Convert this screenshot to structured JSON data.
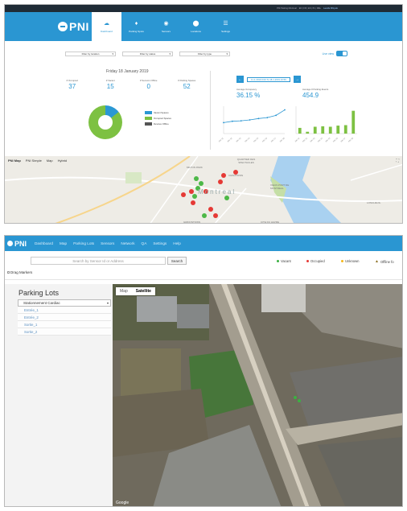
{
  "top": {
    "darkbar": {
      "user": "PNI Parking Montreal",
      "links": "EN | FR | ES | PL | MEL",
      "logout": "Lavalle Mbiyele"
    },
    "brand": "PNI",
    "tabs": [
      {
        "label": "Dashboard",
        "icon": "cloud-icon"
      },
      {
        "label": "Parking Spots",
        "icon": "pin-icon"
      },
      {
        "label": "Sensors",
        "icon": "sensor-icon"
      },
      {
        "label": "Locations",
        "icon": "location-icon"
      },
      {
        "label": "Settings",
        "icon": "sliders-icon"
      }
    ],
    "filters": [
      "Filter by location",
      "Filter by status",
      "Filter by type"
    ],
    "live_label": "Live view",
    "date": "Friday 18 January 2019",
    "stats": [
      {
        "label": "# Occupied",
        "value": "37"
      },
      {
        "label": "# Vacant",
        "value": "15"
      },
      {
        "label": "# Sensors Offline",
        "value": "0"
      },
      {
        "label": "# Parking Spaces",
        "value": "52"
      }
    ],
    "legend": [
      "Vacant Spaces",
      "Occupied Spaces",
      "Devices Offline"
    ],
    "colors": {
      "vacant": "#2b98d3",
      "occupied": "#7dc142",
      "offline": "#555555",
      "accent": "#2a96d2"
    },
    "range_text": "11-1-2019 0:00 To 18-1-2019 23:59",
    "avg_occupancy_label": "Average Occupancy",
    "avg_occupancy_value": "36.15 %",
    "avg_parking_label": "Average # Parking Events",
    "avg_parking_value": "454.9",
    "map_tabs": [
      "PNI Map",
      "PNI Simple",
      "Map",
      "Hybrid"
    ],
    "map_labels": [
      "MILTON PARK",
      "QUARTIER DES SPECTACLES",
      "CHINATOWN",
      "VIEUX-PORT DE MONTREAL",
      "Montreal",
      "GRIFFINTOWN",
      "CITE DU HAVRE",
      "LONGUEUIL"
    ]
  },
  "chart_data": [
    {
      "type": "line",
      "x": [
        "Jan 11",
        "Jan 12",
        "Jan 13",
        "Jan 14",
        "Jan 15",
        "Jan 16",
        "Jan 17",
        "Jan 18"
      ],
      "values": [
        24,
        27,
        28,
        30,
        33,
        35,
        40,
        52
      ],
      "ylim": [
        0,
        60
      ]
    },
    {
      "type": "bar",
      "categories": [
        "Jan 11",
        "Jan 12",
        "Jan 13",
        "Jan 14",
        "Jan 15",
        "Jan 16",
        "Jan 17",
        "Jan 18"
      ],
      "values": [
        250,
        80,
        300,
        320,
        300,
        350,
        370,
        1000
      ],
      "ylim": [
        0,
        1200
      ]
    }
  ],
  "bottom": {
    "brand": "PNI",
    "menu": [
      "Dashboard",
      "Map",
      "Parking Lots",
      "Sensors",
      "Network",
      "QA",
      "Settings",
      "Help"
    ],
    "search_placeholder": "Search by Sensor Id or Address",
    "search_button": "Search",
    "statuses": [
      {
        "label": "Vacant",
        "color": "#3cb043"
      },
      {
        "label": "Occupied",
        "color": "#e53935"
      },
      {
        "label": "Unknown",
        "color": "#f5b81c"
      },
      {
        "label": "Offline fo",
        "color": "#8a6d1d"
      }
    ],
    "drag_label": "Drag Markers",
    "side_title": "Parking Lots",
    "lot_select": "Stationnement Cardiac",
    "lots": [
      "Entrée_1",
      "Entrée_2",
      "Sortie_1",
      "Sortie_2"
    ],
    "map_tabs": [
      "Map",
      "Satellite"
    ],
    "attribution": "Google"
  }
}
